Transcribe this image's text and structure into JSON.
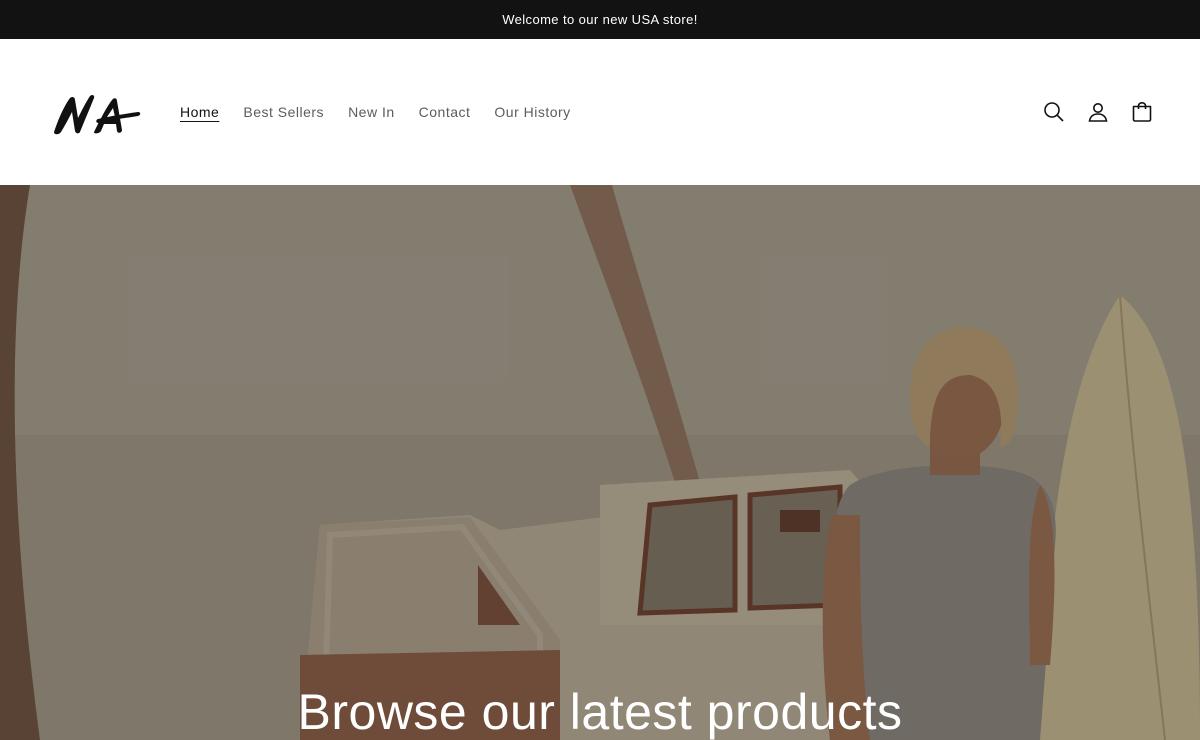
{
  "announcement": {
    "text": "Welcome to our new USA store!"
  },
  "header": {
    "logo_text": "NA",
    "nav": [
      {
        "label": "Home",
        "active": true
      },
      {
        "label": "Best Sellers",
        "active": false
      },
      {
        "label": "New In",
        "active": false
      },
      {
        "label": "Contact",
        "active": false
      },
      {
        "label": "Our History",
        "active": false
      }
    ],
    "icons": [
      "search-icon",
      "account-icon",
      "cart-icon"
    ]
  },
  "hero": {
    "heading": "Browse our latest products",
    "image": "vintage photo of a surfer with a surfboard standing next to an old pickup truck"
  },
  "colors": {
    "announcement_bg": "#121212",
    "announcement_text": "#ffffff",
    "nav_active": "#121212",
    "nav_inactive": "#5c5c5c",
    "hero_text": "#ffffff"
  }
}
